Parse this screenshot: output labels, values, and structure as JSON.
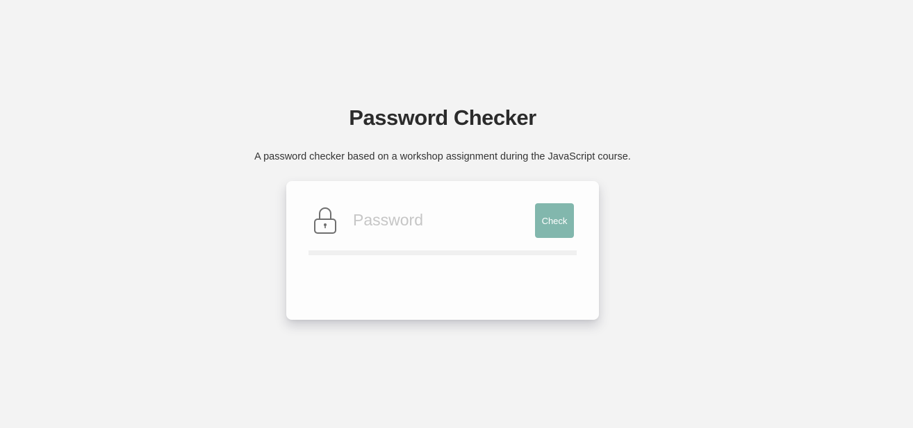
{
  "header": {
    "title": "Password Checker",
    "subtitle": "A password checker based on a workshop assignment during the JavaScript course."
  },
  "card": {
    "icon": "lock-icon",
    "password_input": {
      "value": "",
      "placeholder": "Password"
    },
    "check_button_label": "Check",
    "strength_level": 0
  },
  "colors": {
    "background": "#f3f3f3",
    "card": "#fdfdfd",
    "accent": "#82b7ad",
    "title": "#2b2b2b",
    "placeholder": "#c6c6c6"
  }
}
